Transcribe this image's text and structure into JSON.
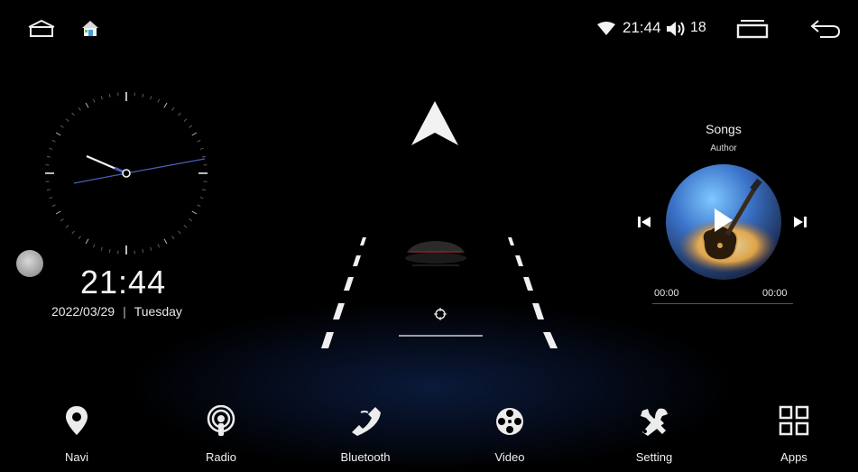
{
  "status_bar": {
    "time": "21:44",
    "volume": "18",
    "icons": [
      "home-outline-icon",
      "home-app-icon",
      "wifi-icon",
      "volume-icon",
      "recent-apps-icon",
      "back-icon"
    ]
  },
  "clock": {
    "time": "21:44",
    "date": "2022/03/29",
    "weekday": "Tuesday"
  },
  "music": {
    "title": "Songs",
    "author": "Author",
    "elapsed": "00:00",
    "duration": "00:00",
    "progress": 0
  },
  "dock": [
    {
      "label": "Navi",
      "icon": "location-pin-icon"
    },
    {
      "label": "Radio",
      "icon": "radio-icon"
    },
    {
      "label": "Bluetooth",
      "icon": "phone-icon"
    },
    {
      "label": "Video",
      "icon": "film-reel-icon"
    },
    {
      "label": "Setting",
      "icon": "tools-icon"
    },
    {
      "label": "Apps",
      "icon": "apps-grid-icon"
    }
  ],
  "colors": {
    "background": "#000000",
    "accent_blue": "#0a1a3a",
    "text": "#f0f0f0"
  }
}
